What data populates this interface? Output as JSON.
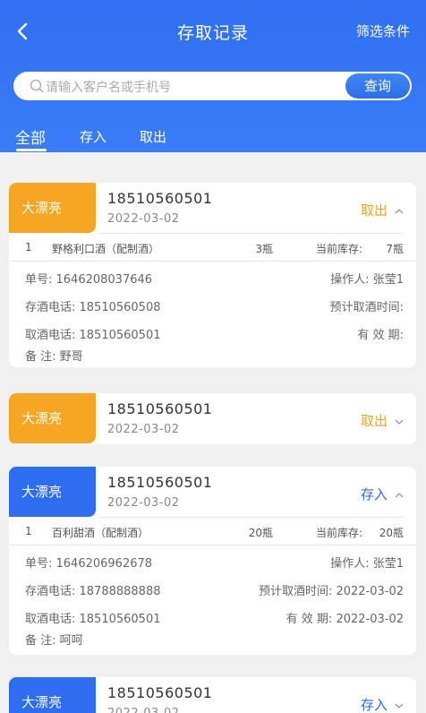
{
  "header": {
    "title": "存取记录",
    "filter_label": "筛选条件",
    "search_placeholder": "请输入客户名或手机号",
    "search_button": "查询"
  },
  "tabs": [
    {
      "label": "全部",
      "active": true
    },
    {
      "label": "存入",
      "active": false
    },
    {
      "label": "取出",
      "active": false
    }
  ],
  "colors": {
    "primary": "#2f6ff2",
    "tag_orange": "#f6a623",
    "tag_blue": "#2d6df0",
    "action_out": "#e9a624",
    "action_in": "#2e6ad6"
  },
  "cards": [
    {
      "name": "大漂亮",
      "phone": "18510560501",
      "date": "2022-03-02",
      "action": "取出",
      "expanded": true,
      "item": {
        "index": "1",
        "name": "野格利口酒（配制酒）",
        "qty": "3瓶",
        "stock_label": "当前库存:",
        "stock": "7瓶"
      },
      "order_no": "单号: 1646208037646",
      "operator": "操作人: 张莹1",
      "store_phone": "存酒电话: 18510560508",
      "pickup_time": "预计取酒时间:",
      "take_phone": "取酒电话: 18510560501",
      "valid": "有 效 期:",
      "remark": "备 注: 野哥"
    },
    {
      "name": "大漂亮",
      "phone": "18510560501",
      "date": "2022-03-02",
      "action": "取出",
      "expanded": false
    },
    {
      "name": "大漂亮",
      "phone": "18510560501",
      "date": "2022-03-02",
      "action": "存入",
      "expanded": true,
      "item": {
        "index": "1",
        "name": "百利甜酒（配制酒）",
        "qty": "20瓶",
        "stock_label": "当前库存:",
        "stock": "20瓶"
      },
      "order_no": "单号: 1646206962678",
      "operator": "操作人: 张莹1",
      "store_phone": "存酒电话: 18788888888",
      "pickup_time": "预计取酒时间: 2022-03-02",
      "take_phone": "取酒电话: 18510560501",
      "valid": "有 效 期: 2022-03-02",
      "remark": "备 注: 呵呵"
    },
    {
      "name": "大漂亮",
      "phone": "18510560501",
      "date": "2022-03-02",
      "action": "存入",
      "expanded": false
    }
  ]
}
